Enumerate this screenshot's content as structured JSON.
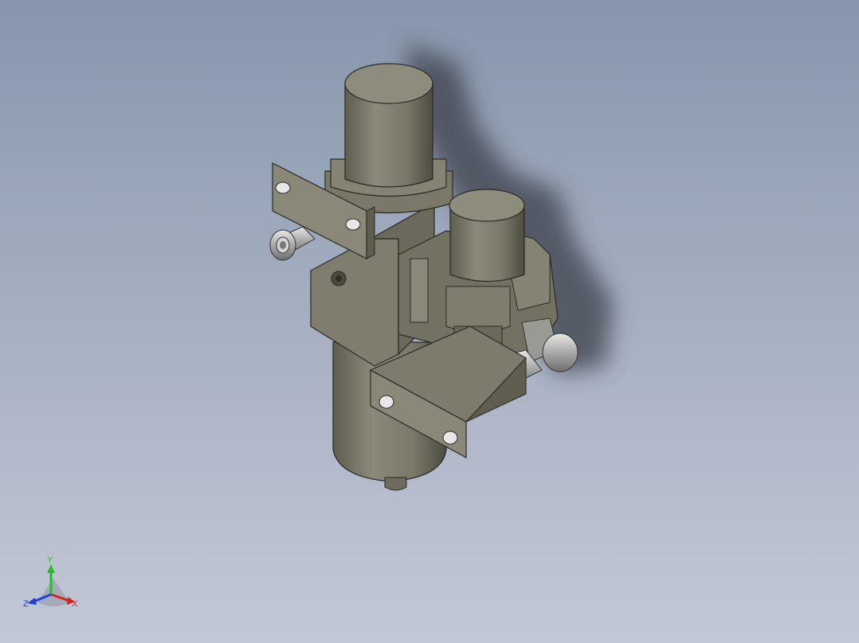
{
  "viewport": {
    "background_top": "#8796ab",
    "background_bottom": "#c3c8d6"
  },
  "model": {
    "body_color": "#7c7b6c",
    "shadow_color": "#3b3f48",
    "fitting_color": "#c9c9c9"
  },
  "triad": {
    "x_label": "X",
    "y_label": "Y",
    "z_label": "Z",
    "x_color": "#d42020",
    "y_color": "#22c022",
    "z_color": "#2040d8"
  }
}
